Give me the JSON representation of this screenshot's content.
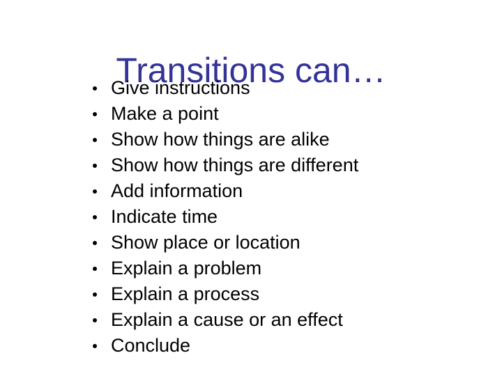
{
  "slide": {
    "title": "Transitions can…",
    "title_color": "#333399",
    "background_color": "#ffffff",
    "body_text_color": "#000000",
    "bullet_marker": "bullet-dot",
    "items": [
      {
        "label": "Give instructions"
      },
      {
        "label": "Make a point"
      },
      {
        "label": "Show how things are alike"
      },
      {
        "label": "Show how things are different"
      },
      {
        "label": "Add information"
      },
      {
        "label": "Indicate time"
      },
      {
        "label": "Show place or location"
      },
      {
        "label": "Explain a problem"
      },
      {
        "label": "Explain a process"
      },
      {
        "label": "Explain a cause or an effect"
      },
      {
        "label": "Conclude"
      }
    ]
  }
}
